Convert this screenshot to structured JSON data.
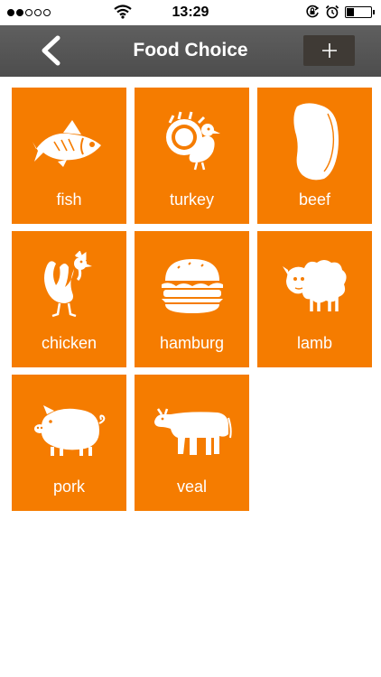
{
  "status_bar": {
    "time": "13:29",
    "signal_filled": 2,
    "signal_total": 5,
    "battery_level": 0.3
  },
  "nav": {
    "title": "Food Choice",
    "back_icon": "chevron-left-icon",
    "add_label": "+"
  },
  "colors": {
    "tile": "#f57c00",
    "nav": "#555555",
    "add_button": "#3f3a35"
  },
  "foods": [
    {
      "label": "fish",
      "icon": "fish-icon"
    },
    {
      "label": "turkey",
      "icon": "turkey-icon"
    },
    {
      "label": "beef",
      "icon": "beef-icon"
    },
    {
      "label": "chicken",
      "icon": "chicken-icon"
    },
    {
      "label": "hamburg",
      "icon": "hamburger-icon"
    },
    {
      "label": "lamb",
      "icon": "lamb-icon"
    },
    {
      "label": "pork",
      "icon": "pig-icon"
    },
    {
      "label": "veal",
      "icon": "cow-icon"
    }
  ]
}
